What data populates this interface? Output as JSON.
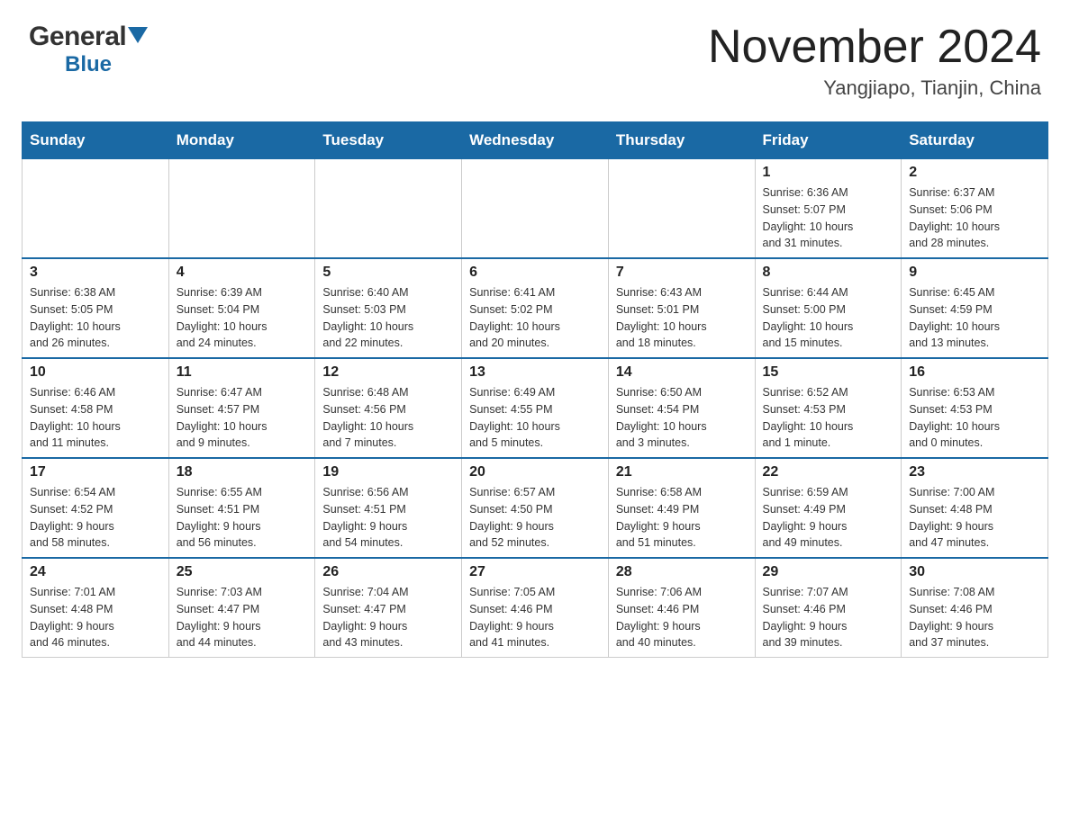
{
  "header": {
    "logo_general": "General",
    "logo_blue": "Blue",
    "month_year": "November 2024",
    "location": "Yangjiapo, Tianjin, China"
  },
  "days_of_week": [
    "Sunday",
    "Monday",
    "Tuesday",
    "Wednesday",
    "Thursday",
    "Friday",
    "Saturday"
  ],
  "weeks": [
    [
      {
        "day": "",
        "info": ""
      },
      {
        "day": "",
        "info": ""
      },
      {
        "day": "",
        "info": ""
      },
      {
        "day": "",
        "info": ""
      },
      {
        "day": "",
        "info": ""
      },
      {
        "day": "1",
        "info": "Sunrise: 6:36 AM\nSunset: 5:07 PM\nDaylight: 10 hours\nand 31 minutes."
      },
      {
        "day": "2",
        "info": "Sunrise: 6:37 AM\nSunset: 5:06 PM\nDaylight: 10 hours\nand 28 minutes."
      }
    ],
    [
      {
        "day": "3",
        "info": "Sunrise: 6:38 AM\nSunset: 5:05 PM\nDaylight: 10 hours\nand 26 minutes."
      },
      {
        "day": "4",
        "info": "Sunrise: 6:39 AM\nSunset: 5:04 PM\nDaylight: 10 hours\nand 24 minutes."
      },
      {
        "day": "5",
        "info": "Sunrise: 6:40 AM\nSunset: 5:03 PM\nDaylight: 10 hours\nand 22 minutes."
      },
      {
        "day": "6",
        "info": "Sunrise: 6:41 AM\nSunset: 5:02 PM\nDaylight: 10 hours\nand 20 minutes."
      },
      {
        "day": "7",
        "info": "Sunrise: 6:43 AM\nSunset: 5:01 PM\nDaylight: 10 hours\nand 18 minutes."
      },
      {
        "day": "8",
        "info": "Sunrise: 6:44 AM\nSunset: 5:00 PM\nDaylight: 10 hours\nand 15 minutes."
      },
      {
        "day": "9",
        "info": "Sunrise: 6:45 AM\nSunset: 4:59 PM\nDaylight: 10 hours\nand 13 minutes."
      }
    ],
    [
      {
        "day": "10",
        "info": "Sunrise: 6:46 AM\nSunset: 4:58 PM\nDaylight: 10 hours\nand 11 minutes."
      },
      {
        "day": "11",
        "info": "Sunrise: 6:47 AM\nSunset: 4:57 PM\nDaylight: 10 hours\nand 9 minutes."
      },
      {
        "day": "12",
        "info": "Sunrise: 6:48 AM\nSunset: 4:56 PM\nDaylight: 10 hours\nand 7 minutes."
      },
      {
        "day": "13",
        "info": "Sunrise: 6:49 AM\nSunset: 4:55 PM\nDaylight: 10 hours\nand 5 minutes."
      },
      {
        "day": "14",
        "info": "Sunrise: 6:50 AM\nSunset: 4:54 PM\nDaylight: 10 hours\nand 3 minutes."
      },
      {
        "day": "15",
        "info": "Sunrise: 6:52 AM\nSunset: 4:53 PM\nDaylight: 10 hours\nand 1 minute."
      },
      {
        "day": "16",
        "info": "Sunrise: 6:53 AM\nSunset: 4:53 PM\nDaylight: 10 hours\nand 0 minutes."
      }
    ],
    [
      {
        "day": "17",
        "info": "Sunrise: 6:54 AM\nSunset: 4:52 PM\nDaylight: 9 hours\nand 58 minutes."
      },
      {
        "day": "18",
        "info": "Sunrise: 6:55 AM\nSunset: 4:51 PM\nDaylight: 9 hours\nand 56 minutes."
      },
      {
        "day": "19",
        "info": "Sunrise: 6:56 AM\nSunset: 4:51 PM\nDaylight: 9 hours\nand 54 minutes."
      },
      {
        "day": "20",
        "info": "Sunrise: 6:57 AM\nSunset: 4:50 PM\nDaylight: 9 hours\nand 52 minutes."
      },
      {
        "day": "21",
        "info": "Sunrise: 6:58 AM\nSunset: 4:49 PM\nDaylight: 9 hours\nand 51 minutes."
      },
      {
        "day": "22",
        "info": "Sunrise: 6:59 AM\nSunset: 4:49 PM\nDaylight: 9 hours\nand 49 minutes."
      },
      {
        "day": "23",
        "info": "Sunrise: 7:00 AM\nSunset: 4:48 PM\nDaylight: 9 hours\nand 47 minutes."
      }
    ],
    [
      {
        "day": "24",
        "info": "Sunrise: 7:01 AM\nSunset: 4:48 PM\nDaylight: 9 hours\nand 46 minutes."
      },
      {
        "day": "25",
        "info": "Sunrise: 7:03 AM\nSunset: 4:47 PM\nDaylight: 9 hours\nand 44 minutes."
      },
      {
        "day": "26",
        "info": "Sunrise: 7:04 AM\nSunset: 4:47 PM\nDaylight: 9 hours\nand 43 minutes."
      },
      {
        "day": "27",
        "info": "Sunrise: 7:05 AM\nSunset: 4:46 PM\nDaylight: 9 hours\nand 41 minutes."
      },
      {
        "day": "28",
        "info": "Sunrise: 7:06 AM\nSunset: 4:46 PM\nDaylight: 9 hours\nand 40 minutes."
      },
      {
        "day": "29",
        "info": "Sunrise: 7:07 AM\nSunset: 4:46 PM\nDaylight: 9 hours\nand 39 minutes."
      },
      {
        "day": "30",
        "info": "Sunrise: 7:08 AM\nSunset: 4:46 PM\nDaylight: 9 hours\nand 37 minutes."
      }
    ]
  ],
  "colors": {
    "header_bg": "#1a69a4",
    "header_text": "#ffffff",
    "border": "#cccccc",
    "day_number": "#222222",
    "day_info": "#333333"
  }
}
